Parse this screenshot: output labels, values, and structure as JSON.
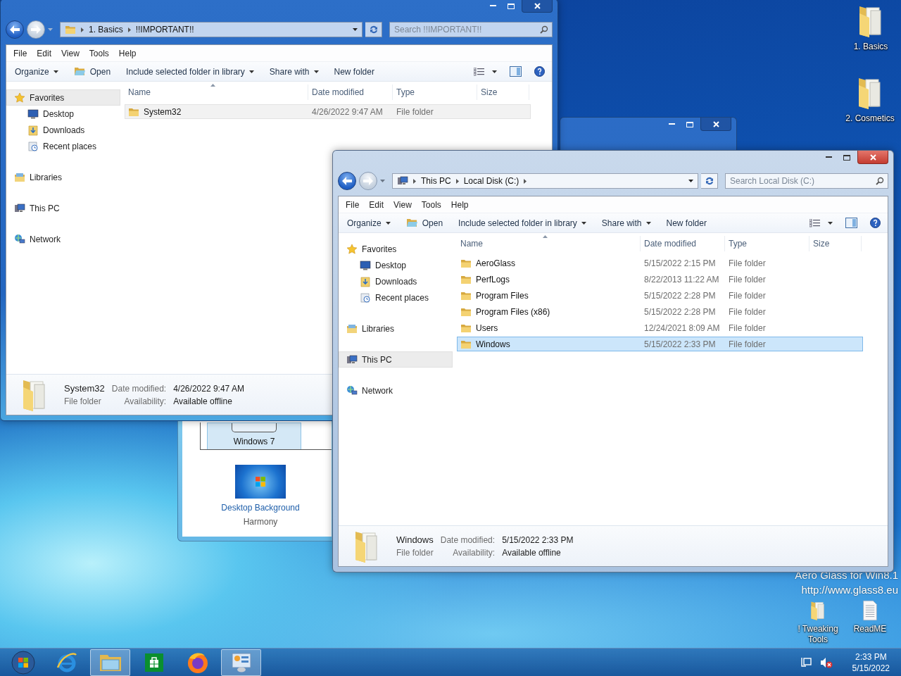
{
  "desktop_icons": [
    {
      "label": "1. Basics",
      "kind": "folder"
    },
    {
      "label": "2. Cosmetics",
      "kind": "folder"
    },
    {
      "label": "! Tweaking Tools",
      "kind": "folder"
    },
    {
      "label": "ReadME",
      "kind": "document"
    }
  ],
  "overlay_text": [
    "Aero Glass for Win8.1",
    "http://www.glass8.eu"
  ],
  "personalization": {
    "theme": {
      "label": "Windows 7",
      "selected": true
    },
    "link": "Desktop Background",
    "caption": "Harmony"
  },
  "explorers": [
    {
      "active": false,
      "location": {
        "kind": "folder"
      },
      "breadcrumb": [
        "1. Basics",
        "!!IMPORTANT!!"
      ],
      "trailing_chevron": false,
      "search_placeholder": "Search !!IMPORTANT!!",
      "menu": [
        "File",
        "Edit",
        "View",
        "Tools",
        "Help"
      ],
      "toolbar": [
        {
          "label": "Organize",
          "kind": "menu"
        },
        {
          "label": "Open",
          "kind": "open"
        },
        {
          "label": "Include selected folder in library",
          "kind": "menu"
        },
        {
          "label": "Share with",
          "kind": "menu"
        },
        {
          "label": "New folder",
          "kind": "plain"
        }
      ],
      "nav": [
        {
          "label": "Favorites",
          "kind": "favorites",
          "selected": true,
          "children": [
            {
              "label": "Desktop",
              "kind": "desktop",
              "selected": false
            },
            {
              "label": "Downloads",
              "kind": "downloads",
              "selected": false
            },
            {
              "label": "Recent places",
              "kind": "recent",
              "selected": false
            }
          ]
        },
        {
          "label": "Libraries",
          "kind": "libraries",
          "selected": false
        },
        {
          "label": "This PC",
          "kind": "pc",
          "selected": false
        },
        {
          "label": "Network",
          "kind": "network",
          "selected": false
        }
      ],
      "columns": [
        "Name",
        "Date modified",
        "Type",
        "Size"
      ],
      "rows": [
        {
          "name": "System32",
          "date": "4/26/2022 9:47 AM",
          "type": "File folder",
          "selected": true
        }
      ],
      "details": {
        "name": "System32",
        "type": "File folder",
        "fields": [
          {
            "label": "Date modified:",
            "value": "4/26/2022 9:47 AM"
          },
          {
            "label": "Availability:",
            "value": "Available offline"
          }
        ]
      }
    },
    {
      "active": true,
      "location": {
        "kind": "pc"
      },
      "breadcrumb": [
        "This PC",
        "Local Disk (C:)"
      ],
      "trailing_chevron": true,
      "search_placeholder": "Search Local Disk (C:)",
      "menu": [
        "File",
        "Edit",
        "View",
        "Tools",
        "Help"
      ],
      "toolbar": [
        {
          "label": "Organize",
          "kind": "menu"
        },
        {
          "label": "Open",
          "kind": "open"
        },
        {
          "label": "Include selected folder in library",
          "kind": "menu"
        },
        {
          "label": "Share with",
          "kind": "menu"
        },
        {
          "label": "New folder",
          "kind": "plain"
        }
      ],
      "nav": [
        {
          "label": "Favorites",
          "kind": "favorites",
          "selected": false,
          "children": [
            {
              "label": "Desktop",
              "kind": "desktop",
              "selected": false
            },
            {
              "label": "Downloads",
              "kind": "downloads",
              "selected": false
            },
            {
              "label": "Recent places",
              "kind": "recent",
              "selected": false
            }
          ]
        },
        {
          "label": "Libraries",
          "kind": "libraries",
          "selected": false
        },
        {
          "label": "This PC",
          "kind": "pc",
          "selected": true
        },
        {
          "label": "Network",
          "kind": "network",
          "selected": false
        }
      ],
      "columns": [
        "Name",
        "Date modified",
        "Type",
        "Size"
      ],
      "rows": [
        {
          "name": "AeroGlass",
          "date": "5/15/2022 2:15 PM",
          "type": "File folder",
          "selected": false
        },
        {
          "name": "PerfLogs",
          "date": "8/22/2013 11:22 AM",
          "type": "File folder",
          "selected": false
        },
        {
          "name": "Program Files",
          "date": "5/15/2022 2:28 PM",
          "type": "File folder",
          "selected": false
        },
        {
          "name": "Program Files (x86)",
          "date": "5/15/2022 2:28 PM",
          "type": "File folder",
          "selected": false
        },
        {
          "name": "Users",
          "date": "12/24/2021 8:09 AM",
          "type": "File folder",
          "selected": false
        },
        {
          "name": "Windows",
          "date": "5/15/2022 2:33 PM",
          "type": "File folder",
          "selected": true
        }
      ],
      "details": {
        "name": "Windows",
        "type": "File folder",
        "fields": [
          {
            "label": "Date modified:",
            "value": "5/15/2022 2:33 PM"
          },
          {
            "label": "Availability:",
            "value": "Available offline"
          }
        ]
      }
    }
  ],
  "taskbar": {
    "apps": [
      {
        "kind": "start",
        "active": false
      },
      {
        "kind": "ie",
        "active": false
      },
      {
        "kind": "explorer",
        "active": true
      },
      {
        "kind": "store",
        "active": false
      },
      {
        "kind": "firefox",
        "active": false
      },
      {
        "kind": "control",
        "active": true
      }
    ],
    "time": "2:33 PM",
    "date": "5/15/2022"
  }
}
